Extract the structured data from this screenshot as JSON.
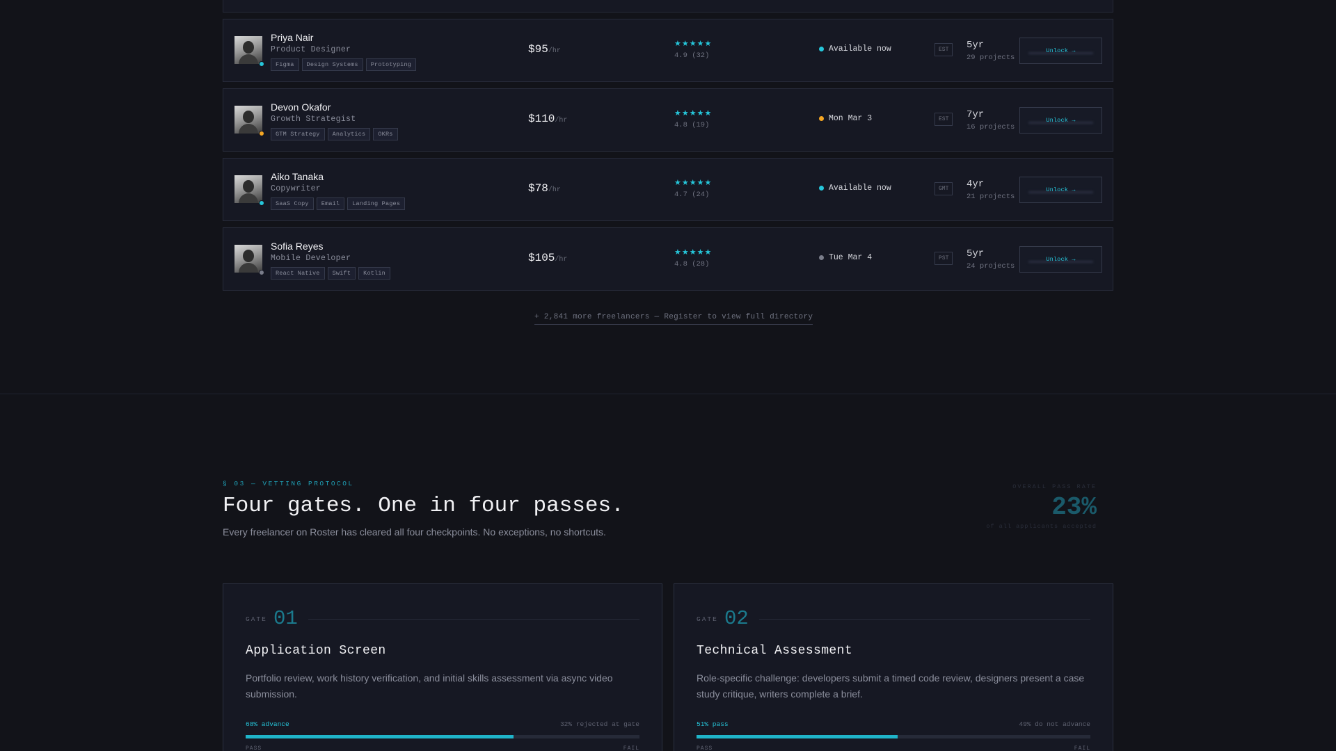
{
  "freelancers": [
    {
      "name": "Priya Nair",
      "role": "Product Designer",
      "tags": [
        "Figma",
        "Design Systems",
        "Prototyping"
      ],
      "rate": "$95",
      "rate_unit": "/hr",
      "stars": "★★★★★",
      "score": "4.9 (32)",
      "availability": "Available now",
      "status_color": "#26c6da",
      "timezone": "EST",
      "experience": "5yr",
      "projects": "29 projects",
      "unlock": "Unlock →"
    },
    {
      "name": "Devon Okafor",
      "role": "Growth Strategist",
      "tags": [
        "GTM Strategy",
        "Analytics",
        "OKRs"
      ],
      "rate": "$110",
      "rate_unit": "/hr",
      "stars": "★★★★★",
      "score": "4.8 (19)",
      "availability": "Mon Mar 3",
      "status_color": "#f5a623",
      "timezone": "EST",
      "experience": "7yr",
      "projects": "16 projects",
      "unlock": "Unlock →"
    },
    {
      "name": "Aiko Tanaka",
      "role": "Copywriter",
      "tags": [
        "SaaS Copy",
        "Email",
        "Landing Pages"
      ],
      "rate": "$78",
      "rate_unit": "/hr",
      "stars": "★★★★★",
      "score": "4.7 (24)",
      "availability": "Available now",
      "status_color": "#26c6da",
      "timezone": "GMT",
      "experience": "4yr",
      "projects": "21 projects",
      "unlock": "Unlock →"
    },
    {
      "name": "Sofia Reyes",
      "role": "Mobile Developer",
      "tags": [
        "React Native",
        "Swift",
        "Kotlin"
      ],
      "rate": "$105",
      "rate_unit": "/hr",
      "stars": "★★★★★",
      "score": "4.8 (28)",
      "availability": "Tue Mar 4",
      "status_color": "#7a7d8a",
      "timezone": "PST",
      "experience": "5yr",
      "projects": "24 projects",
      "unlock": "Unlock →"
    }
  ],
  "more_link": "+ 2,841 more freelancers — Register to view full directory",
  "section": {
    "label": "§ 03 — VETTING PROTOCOL",
    "title": "Four gates. One in four passes.",
    "subtitle": "Every freelancer on Roster has cleared all four checkpoints. No exceptions, no shortcuts.",
    "stat_label": "OVERALL PASS RATE",
    "stat_value": "23%",
    "stat_note": "of all applicants accepted"
  },
  "gates": [
    {
      "label": "GATE",
      "num": "01",
      "title": "Application Screen",
      "desc": "Portfolio review, work history verification, and initial skills assessment via async video submission.",
      "advance": "68% advance",
      "rejected": "32% rejected at gate",
      "pass_fraction": 0.68,
      "pass_lbl": "PASS",
      "fail_lbl": "FAIL"
    },
    {
      "label": "GATE",
      "num": "02",
      "title": "Technical Assessment",
      "desc": "Role-specific challenge: developers submit a timed code review, designers present a case study critique, writers complete a brief.",
      "advance": "51% pass",
      "rejected": "49% do not advance",
      "pass_fraction": 0.51,
      "pass_lbl": "PASS",
      "fail_lbl": "FAIL"
    }
  ],
  "colors": {
    "accent": "#26c6da",
    "available": "#26c6da",
    "pending": "#f5a623",
    "offline": "#7a7d8a"
  }
}
